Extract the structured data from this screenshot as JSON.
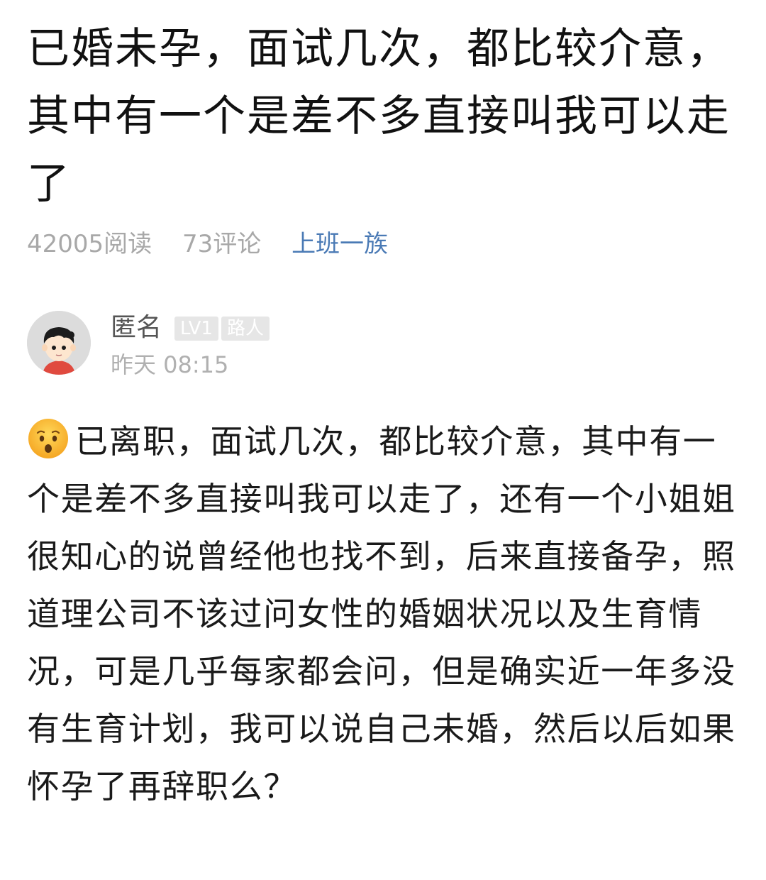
{
  "post": {
    "title": "已婚未孕，面试几次，都比较介意，其中有一个是差不多直接叫我可以走了",
    "reads": "42005阅读",
    "comments": "73评论",
    "topic": "上班一族"
  },
  "author": {
    "name": "匿名",
    "level": "LV1",
    "role": "路人",
    "time": "昨天 08:15",
    "avatar_icon": "cartoon-boy-avatar"
  },
  "content": {
    "leading_emoji": "hushed-face-emoji",
    "text": "已离职，面试几次，都比较介意，其中有一个是差不多直接叫我可以走了，还有一个小姐姐很知心的说曾经他也找不到，后来直接备孕，照道理公司不该过问女性的婚姻状况以及生育情况，可是几乎每家都会问，但是确实近一年多没有生育计划，我可以说自己未婚，然后以后如果怀孕了再辞职么？"
  },
  "colors": {
    "topic_link": "#4a7ab5",
    "meta_gray": "#a8a8a8",
    "badge_bg": "#e6e6e6"
  }
}
